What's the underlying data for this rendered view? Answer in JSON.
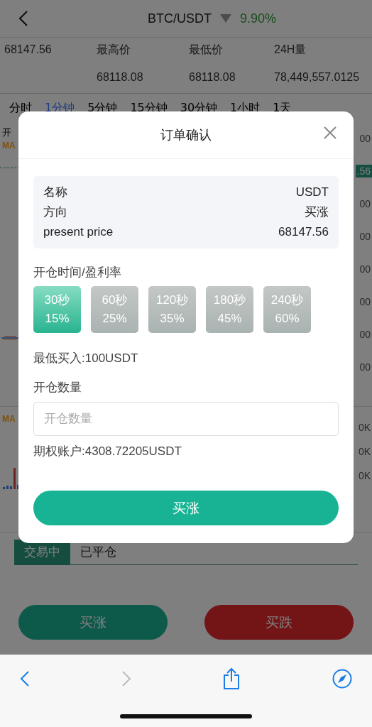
{
  "header": {
    "title": "BTC/USDT",
    "change": "9.90%"
  },
  "stats": {
    "price": "68147.56",
    "labels": [
      "最高价",
      "最低价",
      "24H量"
    ],
    "values": [
      "68118.08",
      "68118.08",
      "78,449,557.0125"
    ]
  },
  "periods": [
    {
      "label": "分时",
      "selected": false
    },
    {
      "label": "1分钟",
      "selected": true
    },
    {
      "label": "5分钟",
      "selected": false
    },
    {
      "label": "15分钟",
      "selected": false
    },
    {
      "label": "30分钟",
      "selected": false
    },
    {
      "label": "1小时",
      "selected": false
    },
    {
      "label": "1天",
      "selected": false
    }
  ],
  "chart": {
    "top_labels": [
      {
        "text": "开",
        "kind": "plain"
      },
      {
        "text": "MA",
        "kind": "indicator"
      }
    ],
    "price_labels": [
      {
        "text": "00",
        "highlighted": false
      },
      {
        "text": ".56",
        "highlighted": true
      },
      {
        "text": "00",
        "highlighted": false
      },
      {
        "text": "00",
        "highlighted": false
      },
      {
        "text": "00",
        "highlighted": false
      },
      {
        "text": "00",
        "highlighted": false
      },
      {
        "text": "00",
        "highlighted": false
      },
      {
        "text": "00",
        "highlighted": false
      }
    ],
    "volume_label": "MA",
    "volume_labels": [
      "0K",
      "0K",
      "0K"
    ]
  },
  "trade_tabs": [
    {
      "label": "交易中",
      "selected": true
    },
    {
      "label": "已平仓",
      "selected": false
    }
  ],
  "actions": [
    {
      "label": "买涨",
      "kind": "up"
    },
    {
      "label": "买跌",
      "kind": "down"
    }
  ],
  "modal": {
    "title": "订单确认",
    "info": [
      {
        "label": "名称",
        "value": "USDT"
      },
      {
        "label": "方向",
        "value": "买涨"
      },
      {
        "label": "present price",
        "value": "68147.56"
      }
    ],
    "period_label": "开仓时间/盈利率",
    "options": [
      {
        "time": "30秒",
        "rate": "15%",
        "selected": true
      },
      {
        "time": "60秒",
        "rate": "25%",
        "selected": false
      },
      {
        "time": "120秒",
        "rate": "35%",
        "selected": false
      },
      {
        "time": "180秒",
        "rate": "45%",
        "selected": false
      },
      {
        "time": "240秒",
        "rate": "60%",
        "selected": false
      }
    ],
    "min_buy": "最低买入:100USDT",
    "quantity_label": "开仓数量",
    "quantity_field": {
      "placeholder": "开仓数量"
    },
    "account": "期权账户:4308.72205USDT",
    "confirm": "买涨"
  },
  "browser": [
    {
      "kind": "back",
      "disabled": false
    },
    {
      "kind": "forward",
      "disabled": true
    },
    {
      "kind": "share",
      "disabled": false
    },
    {
      "kind": "compass",
      "disabled": false
    }
  ]
}
